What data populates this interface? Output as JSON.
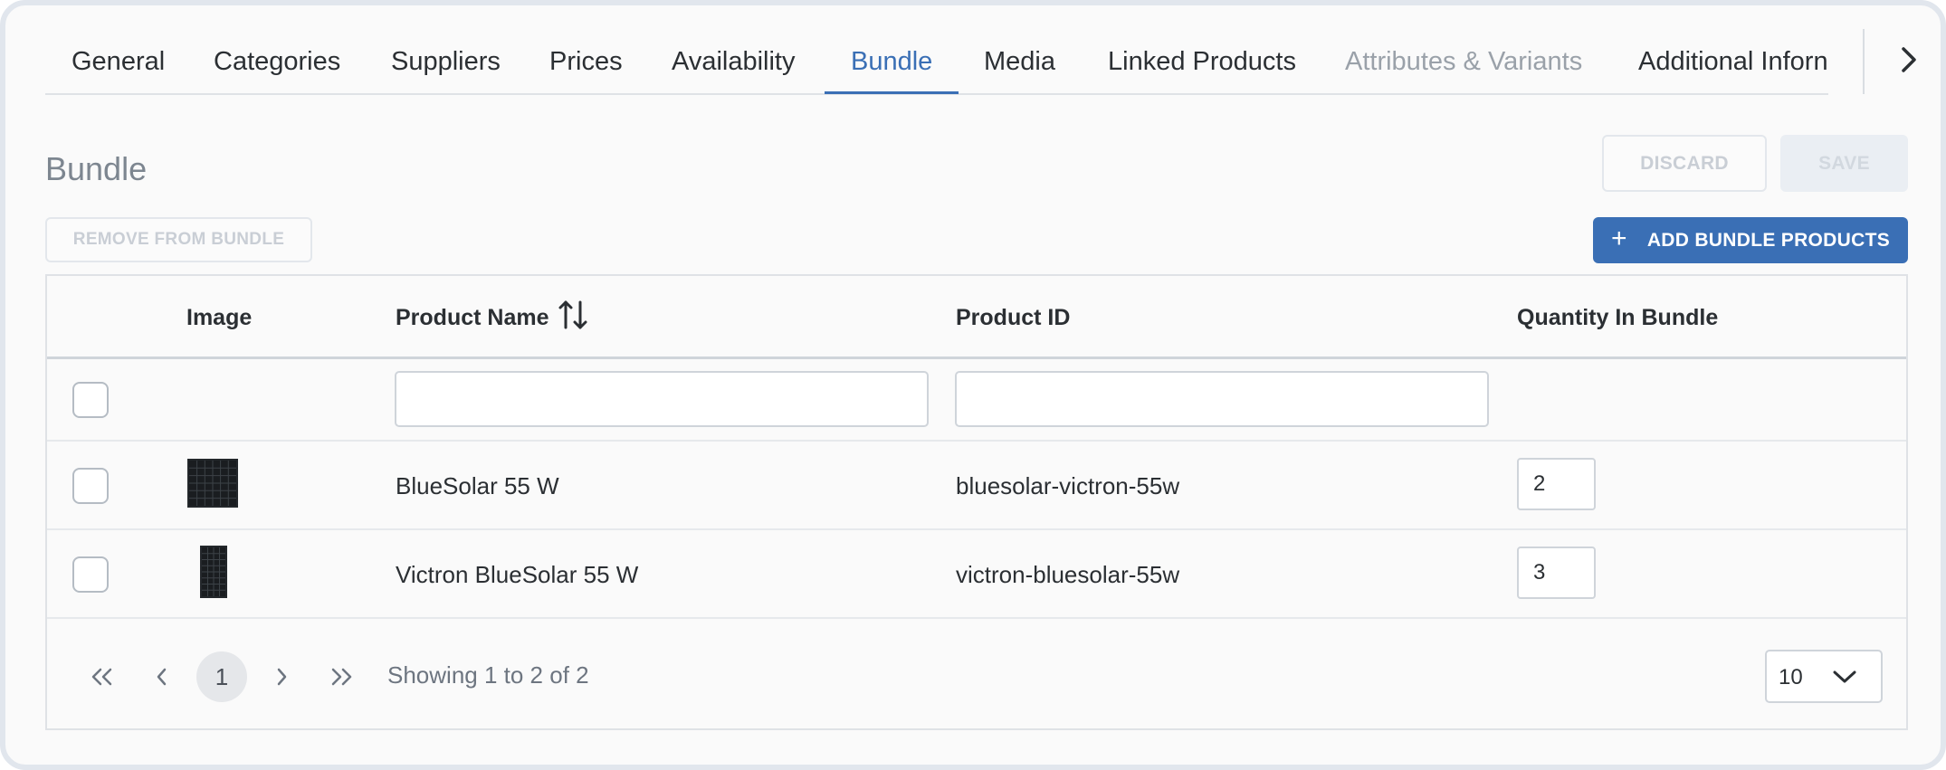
{
  "tabs": [
    {
      "label": "General",
      "state": "normal"
    },
    {
      "label": "Categories",
      "state": "normal"
    },
    {
      "label": "Suppliers",
      "state": "normal"
    },
    {
      "label": "Prices",
      "state": "normal"
    },
    {
      "label": "Availability",
      "state": "normal"
    },
    {
      "label": "Bundle",
      "state": "active"
    },
    {
      "label": "Media",
      "state": "normal"
    },
    {
      "label": "Linked Products",
      "state": "normal"
    },
    {
      "label": "Attributes & Variants",
      "state": "disabled"
    },
    {
      "label": "Additional Inforn",
      "state": "normal"
    }
  ],
  "header": {
    "title": "Bundle",
    "discard_label": "DISCARD",
    "save_label": "SAVE"
  },
  "toolbar": {
    "remove_label": "REMOVE FROM BUNDLE",
    "add_label": "ADD BUNDLE PRODUCTS"
  },
  "table": {
    "columns": {
      "image": "Image",
      "product_name": "Product Name",
      "product_id": "Product ID",
      "quantity": "Quantity In Bundle"
    },
    "filters": {
      "product_name": "",
      "product_id": ""
    },
    "rows": [
      {
        "name": "BlueSolar 55 W",
        "id": "bluesolar-victron-55w",
        "quantity": "2",
        "image": "solar-panel-landscape"
      },
      {
        "name": "Victron BlueSolar 55 W",
        "id": "victron-bluesolar-55w",
        "quantity": "3",
        "image": "solar-panel-portrait"
      }
    ]
  },
  "pagination": {
    "current_page": "1",
    "showing": "Showing 1 to 2 of 2",
    "page_size": "10"
  },
  "colors": {
    "accent": "#3a6fb5",
    "muted_text": "#7d8690",
    "border": "#dfe2e6"
  }
}
